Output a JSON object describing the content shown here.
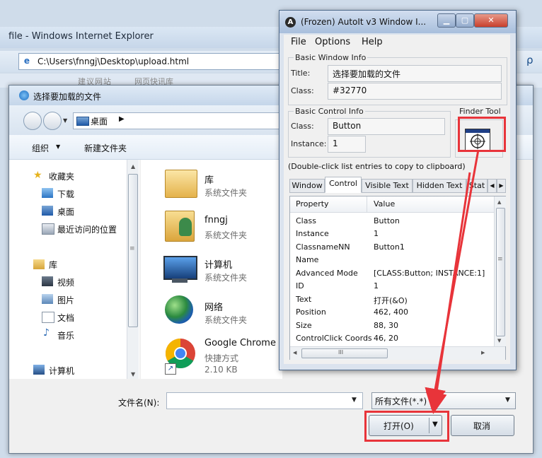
{
  "ie": {
    "title": "file - Windows Internet Explorer",
    "address": "C:\\Users\\fnngj\\Desktop\\upload.html",
    "favbar_item1": "建议网站",
    "favbar_item2": "网页快讯库",
    "search_glyph": "ρ"
  },
  "open_dialog": {
    "title": "选择要加载的文件",
    "path": "桌面",
    "toolbar": {
      "organize": "组织",
      "new_folder": "新建文件夹"
    },
    "nav": {
      "favorites": "收藏夹",
      "favorites_items": [
        "下载",
        "桌面",
        "最近访问的位置"
      ],
      "libraries": "库",
      "library_items": [
        "视频",
        "图片",
        "文档",
        "音乐"
      ],
      "computer": "计算机"
    },
    "files": [
      {
        "name": "库",
        "sub": "系统文件夹",
        "icon": "library-folder-icon"
      },
      {
        "name": "fnngj",
        "sub": "系统文件夹",
        "icon": "user-folder-icon"
      },
      {
        "name": "计算机",
        "sub": "系统文件夹",
        "icon": "computer-icon"
      },
      {
        "name": "网络",
        "sub": "系统文件夹",
        "icon": "network-globe-icon"
      },
      {
        "name": "Google Chrome",
        "sub": "快捷方式",
        "sub2": "2.10 KB",
        "icon": "chrome-icon"
      }
    ],
    "filename_label": "文件名(N):",
    "filename_value": "",
    "filter_value": "所有文件(*.*)",
    "open_button": "打开(O)",
    "cancel_button": "取消"
  },
  "autoit": {
    "title": "(Frozen) AutoIt v3 Window I...",
    "menu": [
      "File",
      "Options",
      "Help"
    ],
    "basic_window_info": "Basic Window Info",
    "title_label": "Title:",
    "title_value": "选择要加载的文件",
    "class_label": "Class:",
    "class_value": "#32770",
    "basic_control_info": "Basic Control Info",
    "ctrl_class_label": "Class:",
    "ctrl_class_value": "Button",
    "instance_label": "Instance:",
    "instance_value": "1",
    "finder_tool": "Finder Tool",
    "hint": "(Double-click list entries to copy to clipboard)",
    "tabs": [
      "Window",
      "Control",
      "Visible Text",
      "Hidden Text",
      "Stat"
    ],
    "active_tab": "Control",
    "property_header": "Property",
    "value_header": "Value",
    "properties": [
      {
        "k": "Class",
        "v": "Button"
      },
      {
        "k": "Instance",
        "v": "1"
      },
      {
        "k": "ClassnameNN",
        "v": "Button1"
      },
      {
        "k": "Name",
        "v": ""
      },
      {
        "k": "Advanced Mode",
        "v": "[CLASS:Button; INSTANCE:1]"
      },
      {
        "k": "ID",
        "v": "1"
      },
      {
        "k": "Text",
        "v": "打开(&O)"
      },
      {
        "k": "Position",
        "v": "462, 400"
      },
      {
        "k": "Size",
        "v": "88, 30"
      },
      {
        "k": "ControlClick Coords",
        "v": "46, 20"
      }
    ],
    "hscroll_grip": "III",
    "vscroll_grip": "≡"
  },
  "colors": {
    "highlight_red": "#e8343a",
    "autoit_frame": "#dbe3ee"
  }
}
